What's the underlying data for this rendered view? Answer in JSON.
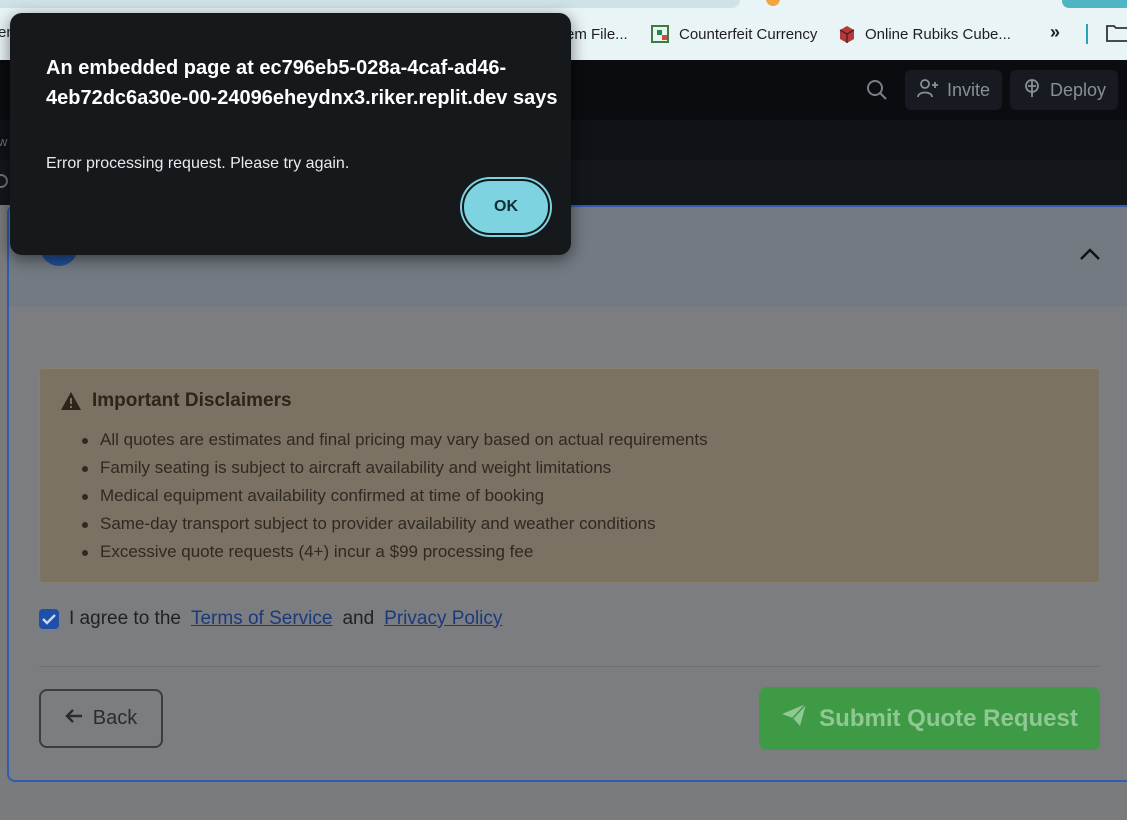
{
  "bookmarks": {
    "partial_left": "en",
    "items": [
      {
        "label": "em File...",
        "icon": "document-icon"
      },
      {
        "label": "Counterfeit Currency",
        "icon": "sheets-icon"
      },
      {
        "label": "Online Rubiks Cube...",
        "icon": "cube-icon"
      }
    ],
    "overflow": "»"
  },
  "replit_bar": {
    "invite_label": "Invite",
    "deploy_label": "Deploy",
    "sub_partial": "w"
  },
  "disclaimers": {
    "title": "Important Disclaimers",
    "items": [
      "All quotes are estimates and final pricing may vary based on actual requirements",
      "Family seating is subject to aircraft availability and weight limitations",
      "Medical equipment availability confirmed at time of booking",
      "Same-day transport subject to provider availability and weather conditions",
      "Excessive quote requests (4+) incur a $99 processing fee"
    ]
  },
  "agreement": {
    "prefix": "I agree to the",
    "terms_link": "Terms of Service",
    "conjunction": "and",
    "privacy_link": "Privacy Policy",
    "checked": true
  },
  "actions": {
    "back_label": "Back",
    "submit_label": "Submit Quote Request"
  },
  "dialog": {
    "title": "An embedded page at ec796eb5-028a-4caf-ad46-4eb72dc6a30e-00-24096eheydnx3.riker.replit.dev says",
    "message": "Error processing request. Please try again.",
    "ok_label": "OK"
  },
  "colors": {
    "dialog_bg": "#15191c",
    "ok_accent": "#7dd3e0",
    "submit_green": "#3f9a45",
    "card_border": "#2f5bb0"
  }
}
